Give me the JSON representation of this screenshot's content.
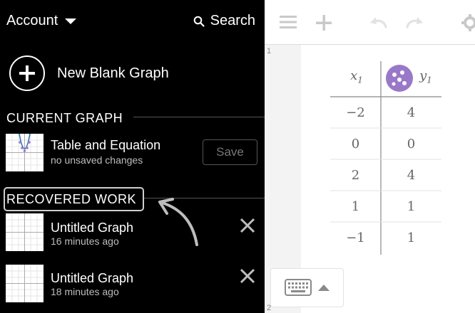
{
  "sidebar": {
    "account_label": "Account",
    "search_label": "Search",
    "new_blank_graph": "New Blank Graph",
    "current_graph": {
      "heading": "CURRENT GRAPH",
      "title": "Table and Equation",
      "status": "no unsaved changes",
      "save_label": "Save"
    },
    "recovered_work": {
      "heading": "RECOVERED WORK",
      "items": [
        {
          "title": "Untitled Graph",
          "time": "16 minutes ago"
        },
        {
          "title": "Untitled Graph",
          "time": "18 minutes ago"
        }
      ]
    }
  },
  "graph": {
    "line_numbers": [
      "1",
      "2"
    ],
    "table": {
      "headers": [
        "x",
        "y"
      ],
      "header_subscripts": [
        "1",
        "1"
      ],
      "rows": [
        [
          "−2",
          "4"
        ],
        [
          "0",
          "0"
        ],
        [
          "2",
          "4"
        ],
        [
          "1",
          "1"
        ],
        [
          "−1",
          "1"
        ]
      ]
    },
    "point_color": "#9a78c8"
  },
  "icons": {
    "account_caret": "caret-down-icon",
    "search": "search-icon",
    "new_graph": "plus-circle-icon",
    "menu": "hamburger-icon",
    "add": "plus-icon",
    "undo": "undo-icon",
    "redo": "redo-icon",
    "settings": "gear-icon",
    "keypad": "keyboard-icon"
  }
}
